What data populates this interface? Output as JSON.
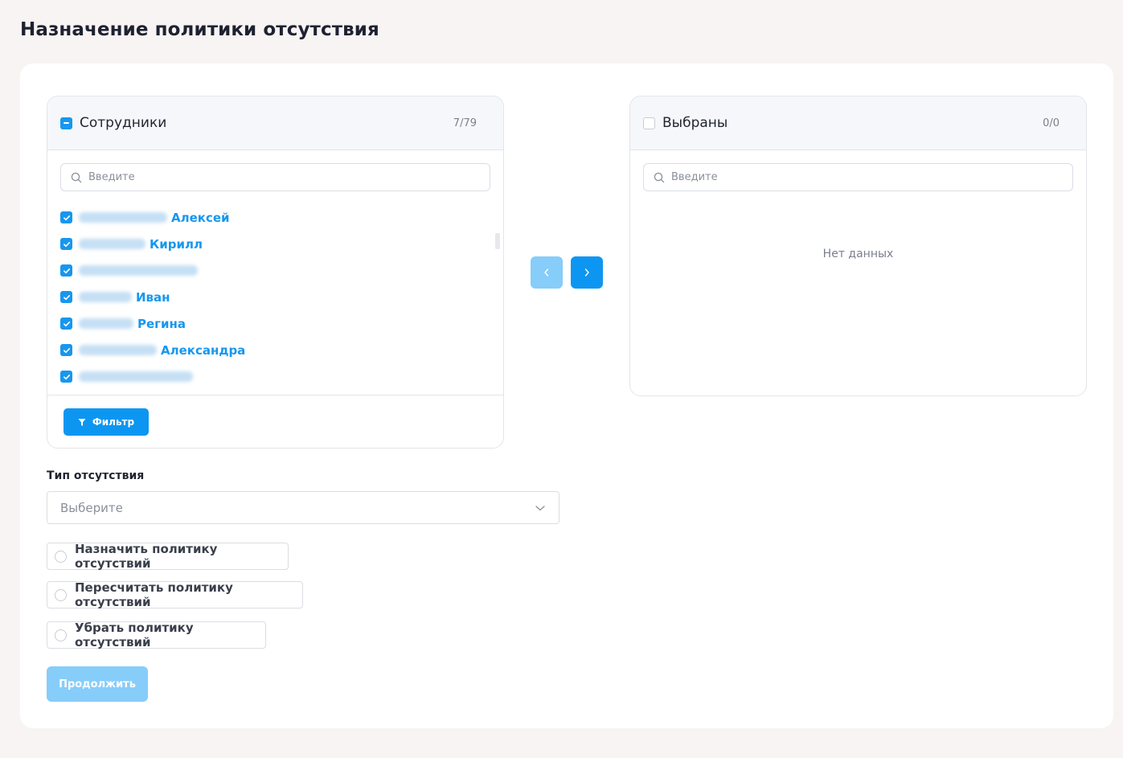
{
  "page": {
    "title": "Назначение политики отсутствия"
  },
  "left_panel": {
    "title": "Сотрудники",
    "count": "7/79",
    "search_placeholder": "Введите",
    "items": [
      {
        "name": "Алексей",
        "checked": true
      },
      {
        "name": "Кирилл",
        "checked": true
      },
      {
        "name": "",
        "checked": true
      },
      {
        "name": "Иван",
        "checked": true
      },
      {
        "name": "Регина",
        "checked": true
      },
      {
        "name": "Александра",
        "checked": true
      },
      {
        "name": "",
        "checked": true
      }
    ],
    "filter_label": "Фильтр"
  },
  "right_panel": {
    "title": "Выбраны",
    "count": "0/0",
    "search_placeholder": "Введите",
    "empty_text": "Нет данных"
  },
  "absence_type": {
    "label": "Тип отсутствия",
    "placeholder": "Выберите"
  },
  "actions": [
    {
      "label": "Назначить политику отсутствий"
    },
    {
      "label": "Пересчитать политику отсутствий"
    },
    {
      "label": "Убрать политику отсутствий"
    }
  ],
  "continue_label": "Продолжить",
  "colors": {
    "primary": "#0d96f1",
    "primary_disabled": "#86cdfa",
    "link": "#1797ee"
  }
}
